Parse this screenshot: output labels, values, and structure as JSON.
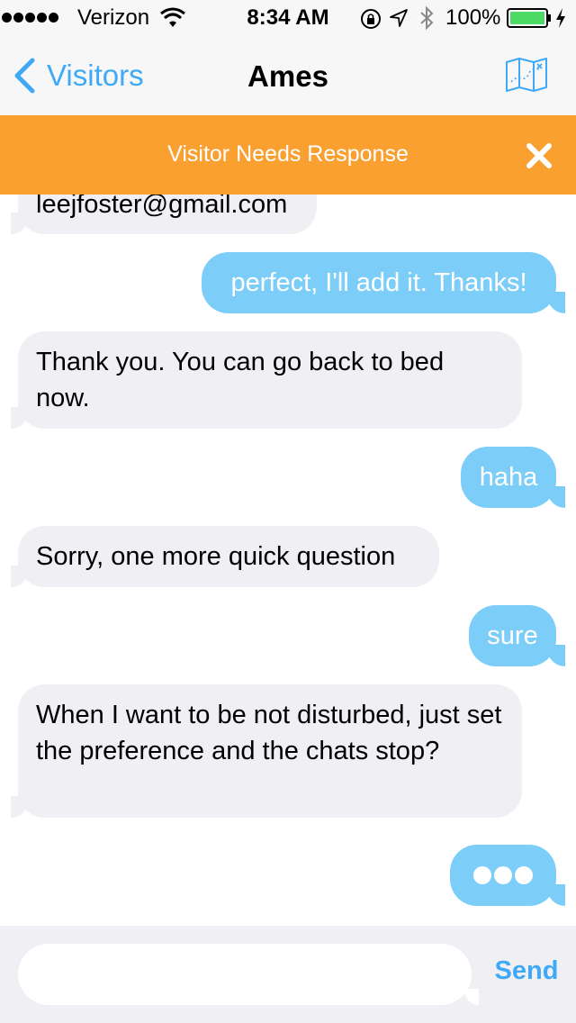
{
  "status_bar": {
    "carrier": "Verizon",
    "time": "8:34 AM",
    "battery": "100%"
  },
  "nav": {
    "back_label": "Visitors",
    "title": "Ames"
  },
  "alert": {
    "text": "Visitor Needs Response"
  },
  "messages": [
    {
      "from": "visitor",
      "text": "leejfoster@gmail.com"
    },
    {
      "from": "agent",
      "text": "perfect, I'll add it. Thanks!"
    },
    {
      "from": "visitor",
      "text": "Thank you.  You can go back to bed now."
    },
    {
      "from": "agent",
      "text": "haha"
    },
    {
      "from": "visitor",
      "text": "Sorry, one more quick question"
    },
    {
      "from": "agent",
      "text": "sure"
    },
    {
      "from": "visitor",
      "text": "When I want to be not disturbed, just set the preference and the chats stop?"
    }
  ],
  "compose": {
    "placeholder": "",
    "send_label": "Send"
  },
  "colors": {
    "accent": "#3fa9f5",
    "alert": "#f9a030",
    "outgoing_bubble": "#7ccdf8",
    "incoming_bubble": "#efeff4"
  },
  "icons": {
    "back": "chevron-left-icon",
    "map": "map-icon",
    "close": "close-icon",
    "wifi": "wifi-icon",
    "battery": "battery-icon",
    "bluetooth": "bluetooth-icon",
    "location": "location-arrow-icon",
    "rotation_lock": "rotation-lock-icon",
    "charging": "charging-bolt-icon"
  }
}
